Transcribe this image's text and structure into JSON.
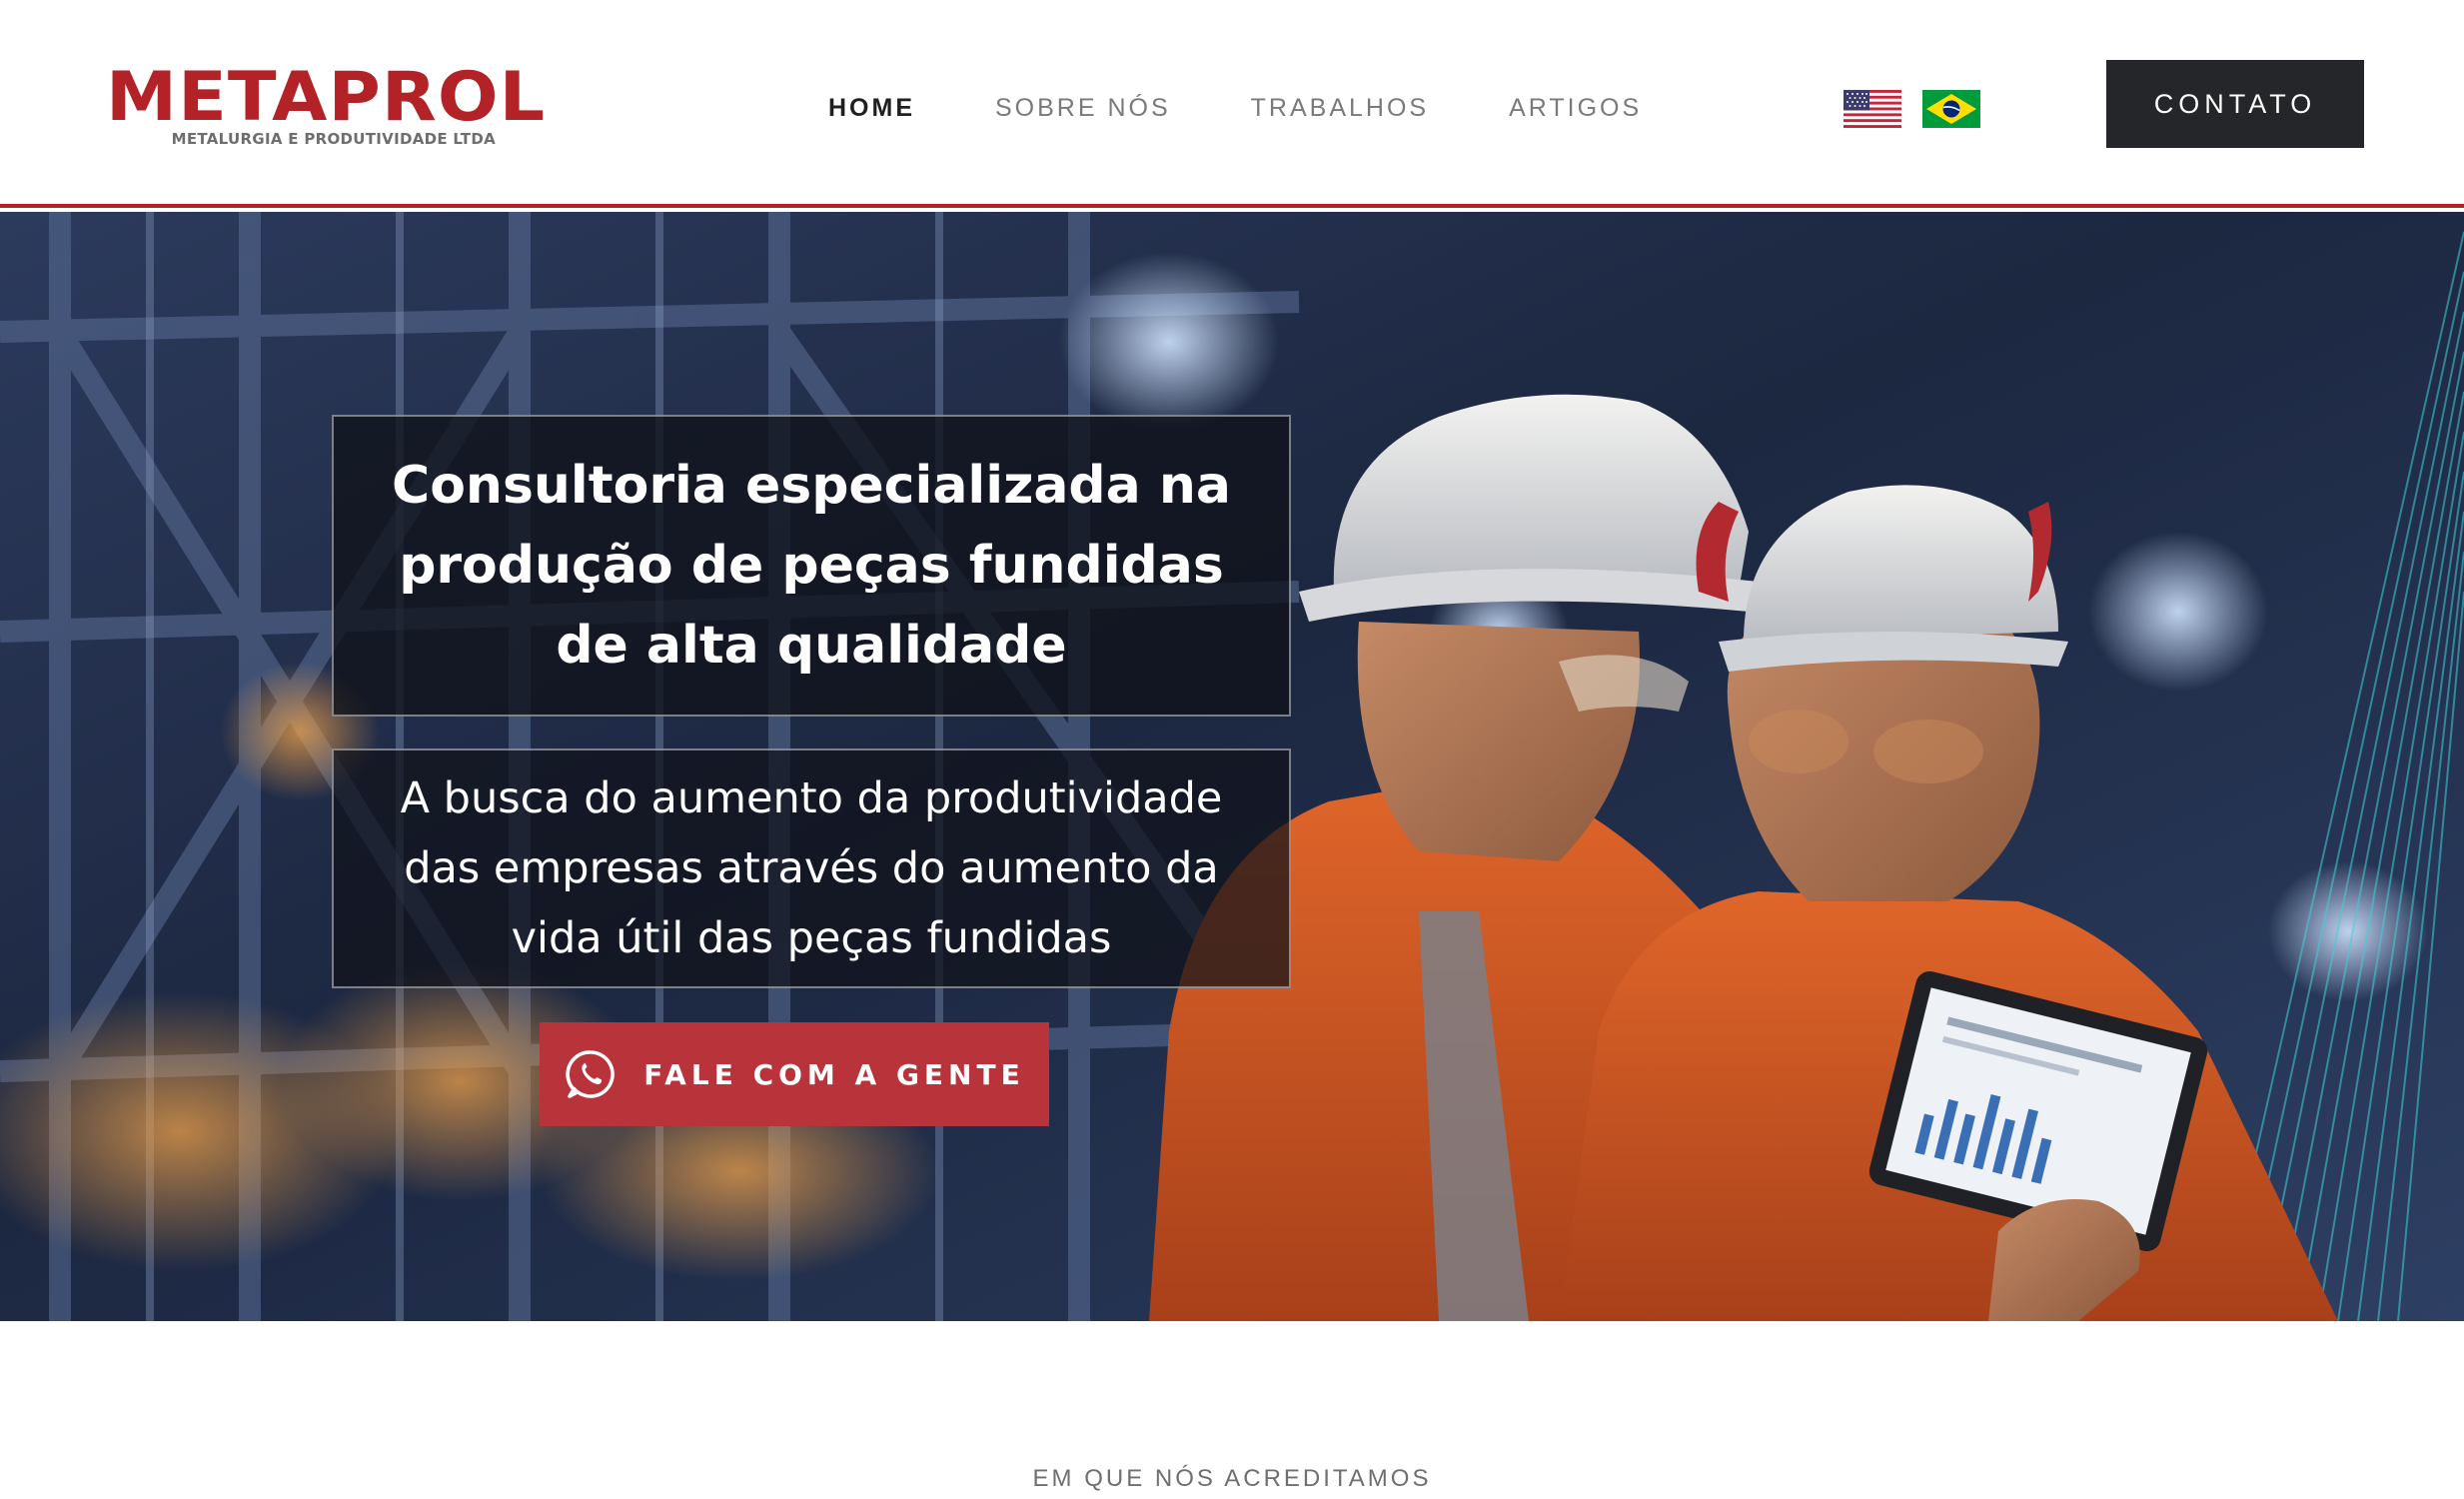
{
  "brand": {
    "name": "METAPROL",
    "tagline": "METALURGIA E PRODUTIVIDADE LTDA",
    "color": "#b32227"
  },
  "nav": {
    "items": [
      {
        "label": "HOME",
        "active": true
      },
      {
        "label": "SOBRE NÓS",
        "active": false
      },
      {
        "label": "TRABALHOS",
        "active": false
      },
      {
        "label": "ARTIGOS",
        "active": false
      }
    ]
  },
  "languages": [
    {
      "icon": "us-flag-icon"
    },
    {
      "icon": "brazil-flag-icon"
    }
  ],
  "contact_button": {
    "label": "CONTATO",
    "color": "#25262a"
  },
  "hero": {
    "headline_lines": [
      "Consultoria especializada na",
      "produção de peças fundidas",
      "de alta qualidade"
    ],
    "subline_lines": [
      "A busca do aumento da produtividade",
      "das empresas através do aumento da",
      "vida útil das peças fundidas"
    ],
    "cta": {
      "label": "FALE COM A GENTE",
      "icon": "whatsapp-icon",
      "color": "#b8333a"
    }
  },
  "section": {
    "eyebrow": "EM QUE NÓS ACREDITAMOS"
  }
}
